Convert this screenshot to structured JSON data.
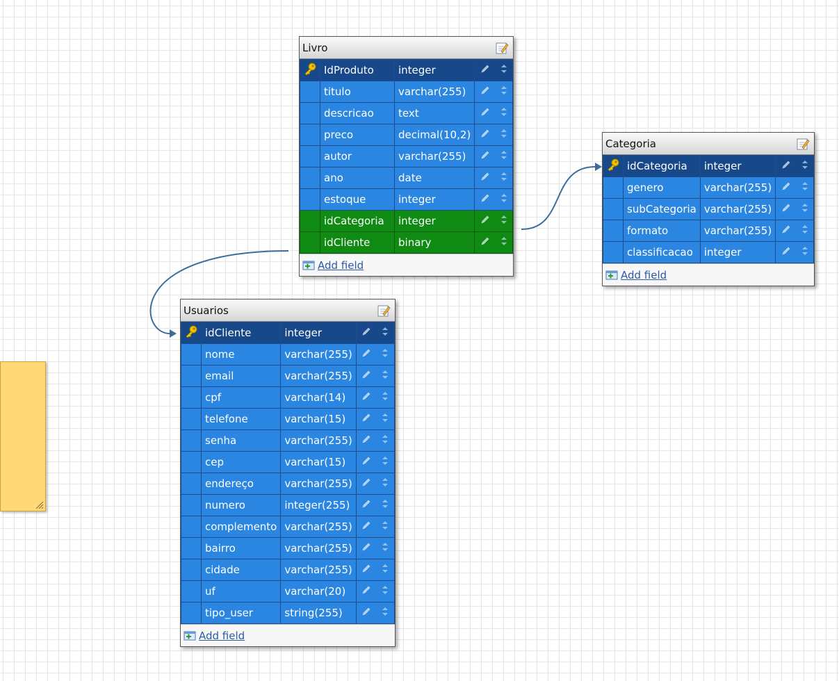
{
  "colors": {
    "pk_row": "#16488a",
    "field_row": "#2a86e0",
    "fk_row": "#0f8a12",
    "link": "#3a6d9a",
    "note": "#ffd978"
  },
  "tables": {
    "livro": {
      "title": "Livro",
      "add_field_label": "Add field",
      "fields": [
        {
          "name": "IdProduto",
          "type": "integer",
          "role": "pk"
        },
        {
          "name": "titulo",
          "type": "varchar(255)",
          "role": "field"
        },
        {
          "name": "descricao",
          "type": "text",
          "role": "field"
        },
        {
          "name": "preco",
          "type": "decimal(10,2)",
          "role": "field"
        },
        {
          "name": "autor",
          "type": "varchar(255)",
          "role": "field"
        },
        {
          "name": "ano",
          "type": "date",
          "role": "field"
        },
        {
          "name": "estoque",
          "type": "integer",
          "role": "field"
        },
        {
          "name": "idCategoria",
          "type": "integer",
          "role": "fk"
        },
        {
          "name": "idCliente",
          "type": "binary",
          "role": "fk"
        }
      ]
    },
    "categoria": {
      "title": "Categoria",
      "add_field_label": "Add field",
      "fields": [
        {
          "name": "idCategoria",
          "type": "integer",
          "role": "pk"
        },
        {
          "name": "genero",
          "type": "varchar(255)",
          "role": "field"
        },
        {
          "name": "subCategoria",
          "type": "varchar(255)",
          "role": "field"
        },
        {
          "name": "formato",
          "type": "varchar(255)",
          "role": "field"
        },
        {
          "name": "classificacao",
          "type": "integer",
          "role": "field"
        }
      ]
    },
    "usuarios": {
      "title": "Usuarios",
      "add_field_label": "Add field",
      "fields": [
        {
          "name": "idCliente",
          "type": "integer",
          "role": "pk"
        },
        {
          "name": "nome",
          "type": "varchar(255)",
          "role": "field"
        },
        {
          "name": "email",
          "type": "varchar(255)",
          "role": "field"
        },
        {
          "name": "cpf",
          "type": "varchar(14)",
          "role": "field"
        },
        {
          "name": "telefone",
          "type": "varchar(15)",
          "role": "field"
        },
        {
          "name": "senha",
          "type": "varchar(255)",
          "role": "field"
        },
        {
          "name": "cep",
          "type": "varchar(15)",
          "role": "field"
        },
        {
          "name": "endereço",
          "type": "varchar(255)",
          "role": "field"
        },
        {
          "name": "numero",
          "type": "integer(255)",
          "role": "field"
        },
        {
          "name": "complemento",
          "type": "varchar(255)",
          "role": "field"
        },
        {
          "name": "bairro",
          "type": "varchar(255)",
          "role": "field"
        },
        {
          "name": "cidade",
          "type": "varchar(255)",
          "role": "field"
        },
        {
          "name": "uf",
          "type": "varchar(20)",
          "role": "field"
        },
        {
          "name": "tipo_user",
          "type": "string(255)",
          "role": "field"
        }
      ]
    }
  },
  "icons": {
    "primary_key": "key-icon",
    "edit_table": "edit-table-icon",
    "edit_field": "pencil-icon",
    "reorder": "reorder-icon",
    "add_field": "add-field-icon",
    "note_resize": "resize-grip-icon"
  }
}
